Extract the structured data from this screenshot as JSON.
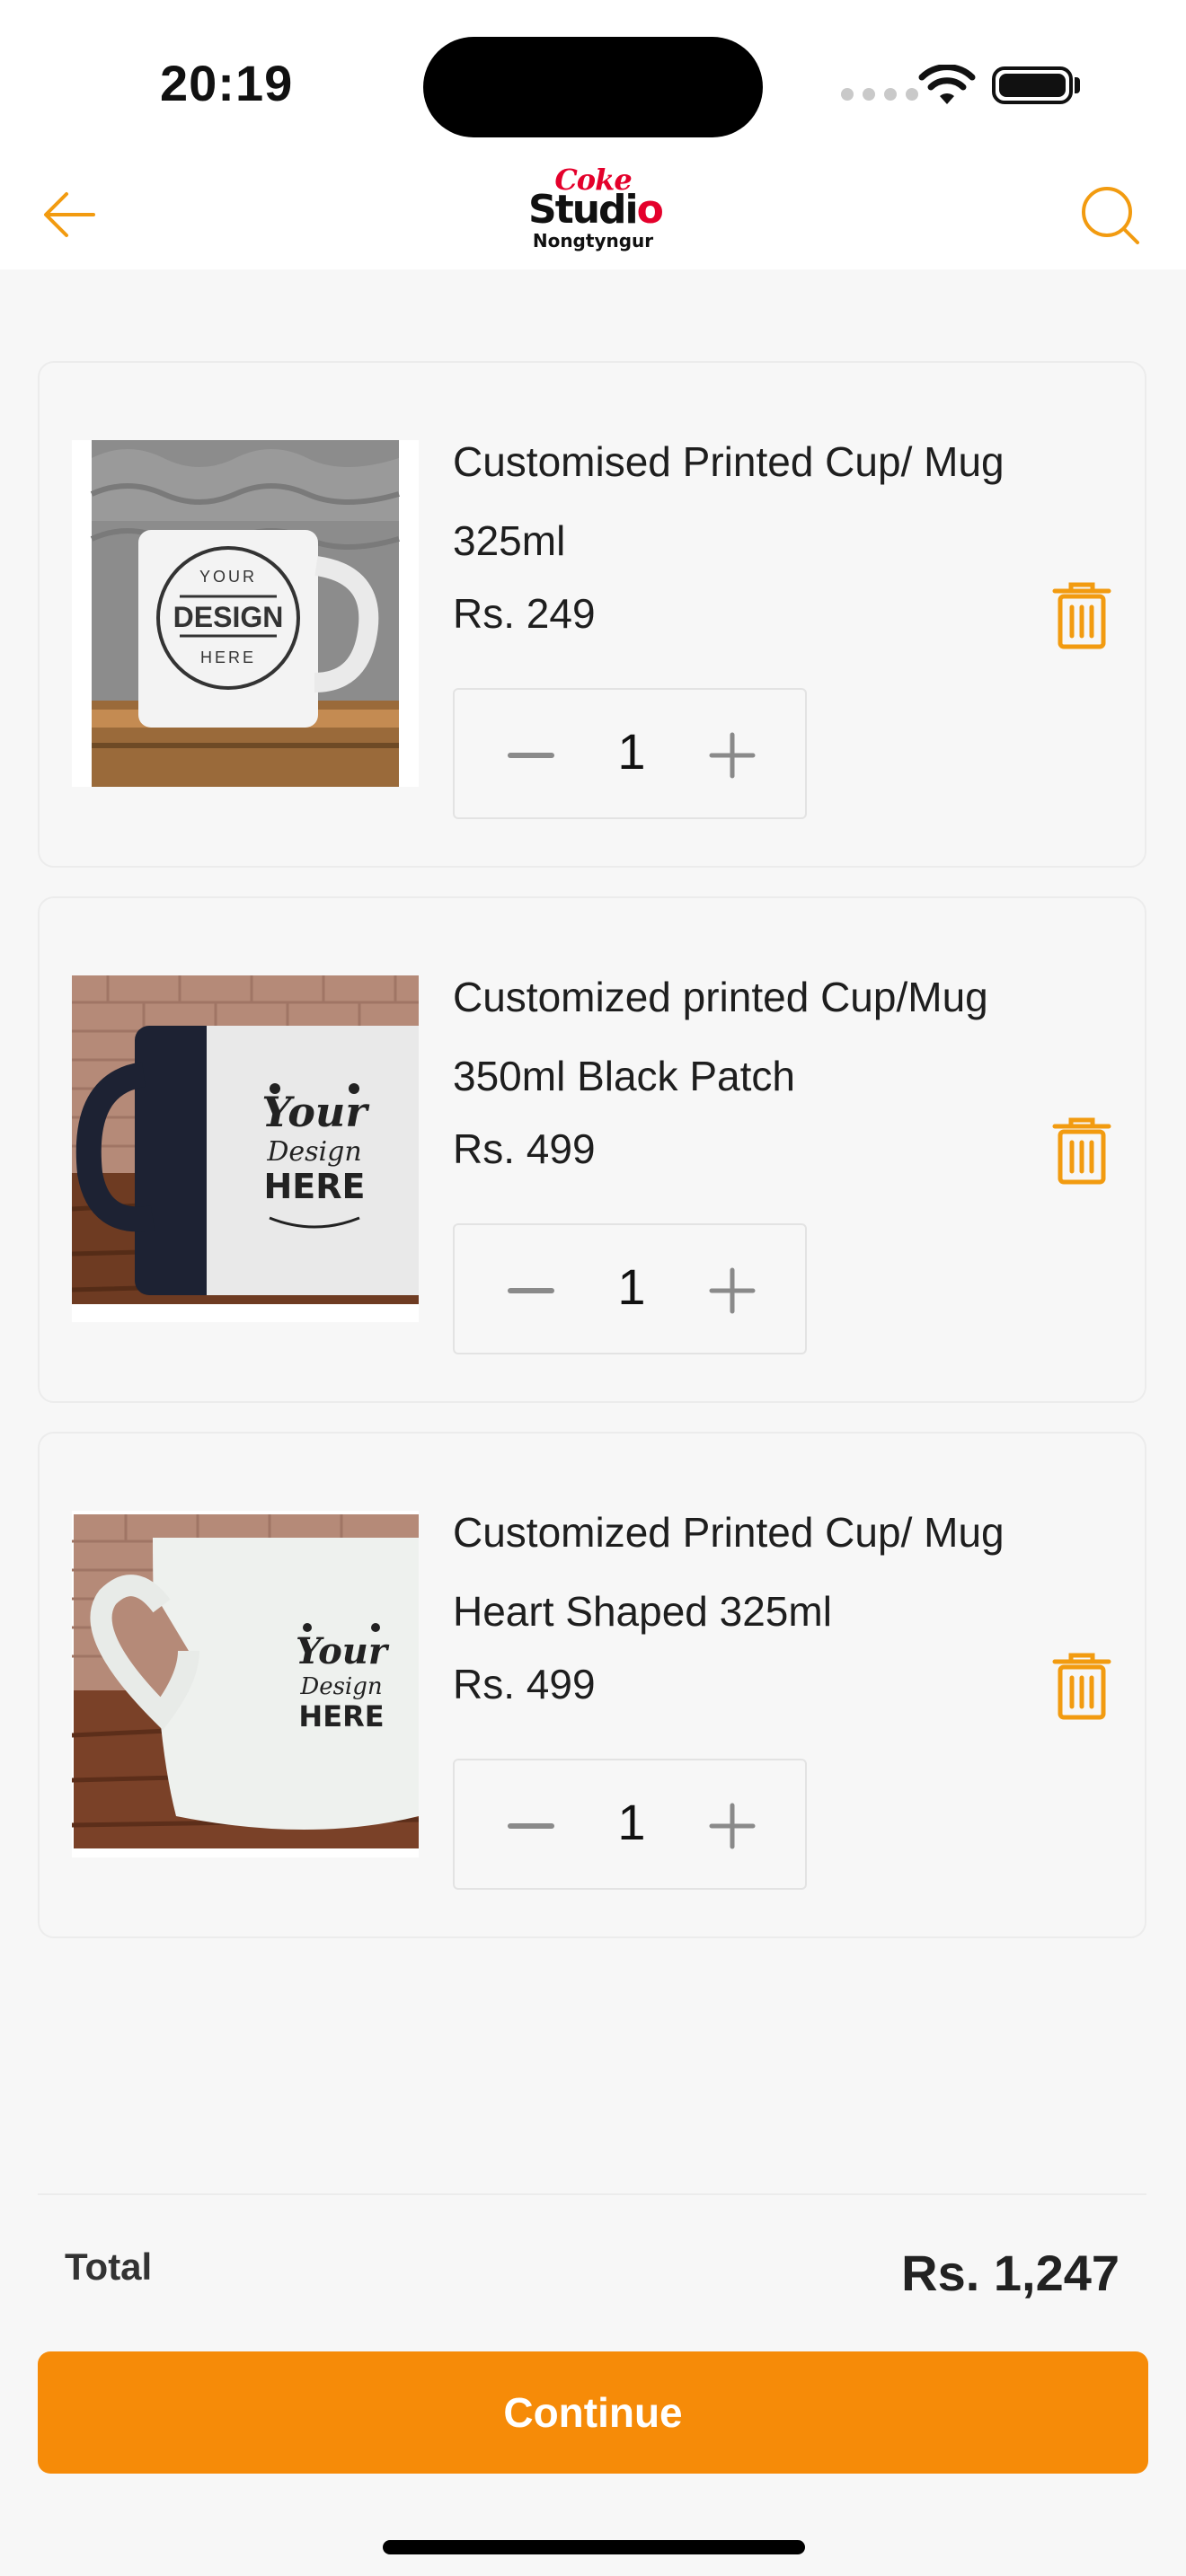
{
  "status_bar": {
    "time": "20:19"
  },
  "header": {
    "logo": {
      "line1": "Coke",
      "line2a": "Studi",
      "line2b": "o",
      "line3": "Nongtyngur"
    },
    "back_icon": "arrow-left-icon",
    "search_icon": "search-icon"
  },
  "cart": {
    "items": [
      {
        "name": "Customised Printed Cup/ Mug 325ml",
        "price": "Rs. 249",
        "quantity": "1",
        "image_text": [
          "YOUR",
          "DESIGN",
          "HERE"
        ]
      },
      {
        "name": "Customized printed Cup/Mug 350ml Black Patch",
        "price": "Rs. 499",
        "quantity": "1",
        "image_text": [
          "Your",
          "Design",
          "HERE"
        ]
      },
      {
        "name": "Customized Printed Cup/ Mug Heart Shaped 325ml",
        "price": "Rs. 499",
        "quantity": "1",
        "image_text": [
          "Your",
          "Design",
          "HERE"
        ]
      }
    ]
  },
  "summary": {
    "total_label": "Total",
    "total_value": "Rs. 1,247"
  },
  "actions": {
    "continue_label": "Continue"
  },
  "colors": {
    "accent": "#f68b08",
    "icon_orange": "#f29b10",
    "logo_red": "#e4002b"
  }
}
